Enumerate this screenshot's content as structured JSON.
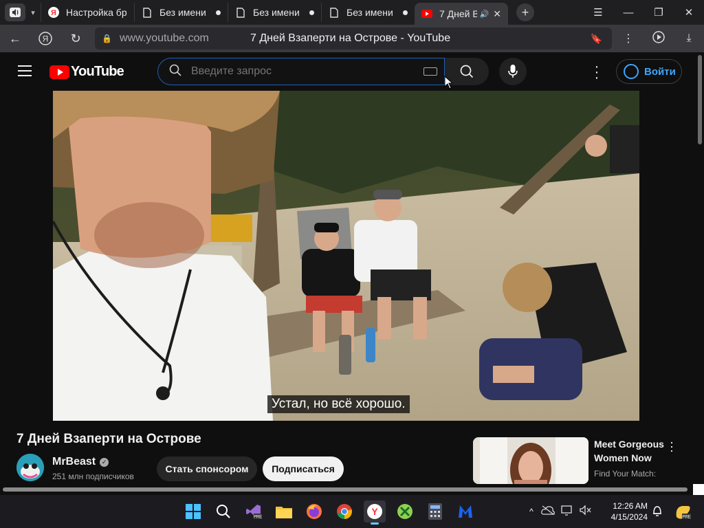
{
  "browser": {
    "tabs": [
      {
        "label": "Настройка бра",
        "favicon": "yandex-icon",
        "state": "normal"
      },
      {
        "label": "Без имени",
        "favicon": "document-icon",
        "state": "unsaved"
      },
      {
        "label": "Без имени",
        "favicon": "document-icon",
        "state": "unsaved"
      },
      {
        "label": "Без имени",
        "favicon": "document-icon",
        "state": "unsaved"
      },
      {
        "label": "7 Дней В",
        "favicon": "youtube-icon",
        "state": "active-playing"
      }
    ],
    "address": {
      "url": "www.youtube.com",
      "page_title": "7 Дней Взаперти на Острове - YouTube"
    }
  },
  "youtube": {
    "logo_text": "YouTube",
    "search": {
      "placeholder": "Введите запрос"
    },
    "signin_label": "Войти",
    "accent": "#ff0000",
    "link_color": "#3ea6ff"
  },
  "video": {
    "subtitle": "Устал, но всё хорошо.",
    "title": "7 Дней Взаперти на Острове",
    "channel": {
      "name": "MrBeast",
      "subscribers": "251 млн подписчиков",
      "verified": true
    },
    "sponsor_label": "Стать спонсором",
    "subscribe_label": "Подписаться"
  },
  "ad": {
    "title": "Meet Gorgeous Women Now",
    "subtitle": "Find Your Match:"
  },
  "taskbar": {
    "apps": [
      "windows-start-icon",
      "search-icon",
      "visual-studio-icon",
      "file-explorer-icon",
      "firefox-icon",
      "chrome-icon",
      "yandex-browser-icon",
      "xbox-icon",
      "calculator-icon",
      "malwarebytes-icon"
    ],
    "time": "12:26 AM",
    "date": "4/15/2024"
  }
}
